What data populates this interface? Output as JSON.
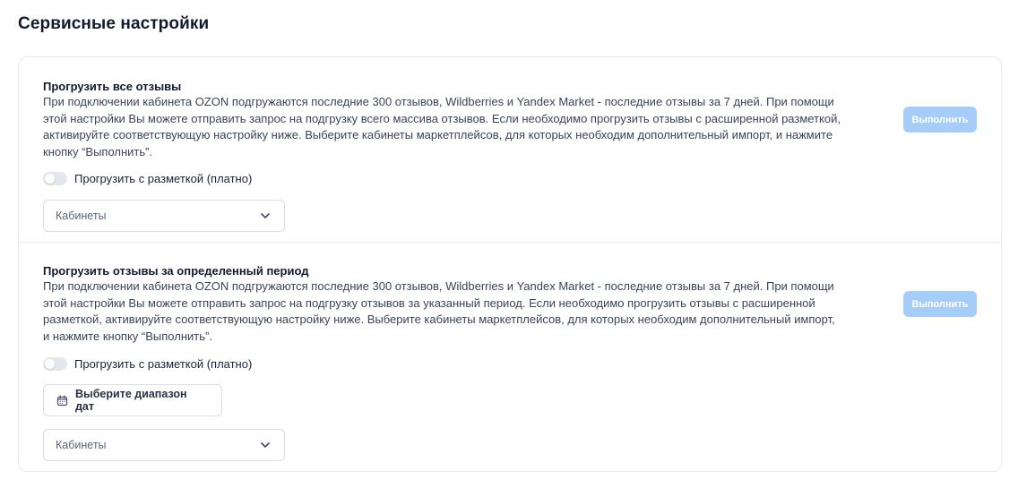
{
  "page": {
    "title": "Сервисные настройки"
  },
  "sections": [
    {
      "title": "Прогрузить все отзывы",
      "description": [
        "При подключении кабинета OZON подгружаются последние 300 отзывов, Wildberries и Yandex Market - последние отзывы за 7 дней. При помощи",
        "этой настройки Вы можете отправить запрос на подгрузку всего массива отзывов. Если необходимо прогрузить отзывы с расширенной разметкой,",
        "активируйте соответствующую настройку ниже. Выберите кабинеты маркетплейсов, для которых необходим дополнительный импорт, и нажмите",
        "кнопку “Выполнить”."
      ],
      "toggle_label": "Прогрузить с разметкой (платно)",
      "toggle_on": false,
      "select_placeholder": "Кабинеты",
      "button_label": "Выполнить"
    },
    {
      "title": "Прогрузить отзывы за определенный период",
      "description": [
        "При подключении кабинета OZON подгружаются последние 300 отзывов, Wildberries и Yandex Market - последние отзывы за 7 дней. При помощи",
        "этой настройки Вы можете отправить запрос на подгрузку отзывов за указанный период. Если необходимо прогрузить отзывы с расширенной",
        "разметкой, активируйте соответствующую настройку ниже. Выберите кабинеты маркетплейсов, для которых необходим дополнительный импорт,",
        "и нажмите кнопку “Выполнить”."
      ],
      "toggle_label": "Прогрузить с разметкой (платно)",
      "toggle_on": false,
      "date_range_label": "Выберите диапазон дат",
      "select_placeholder": "Кабинеты",
      "button_label": "Выполнить"
    }
  ],
  "colors": {
    "button_disabled_bg": "#a6cdf8",
    "toggle_off_bg": "#e4e7ec",
    "border": "#d9dde4",
    "title_text": "#141a2c"
  },
  "icons": {
    "dropdown": "chevron-down-icon",
    "date": "calendar-icon"
  }
}
